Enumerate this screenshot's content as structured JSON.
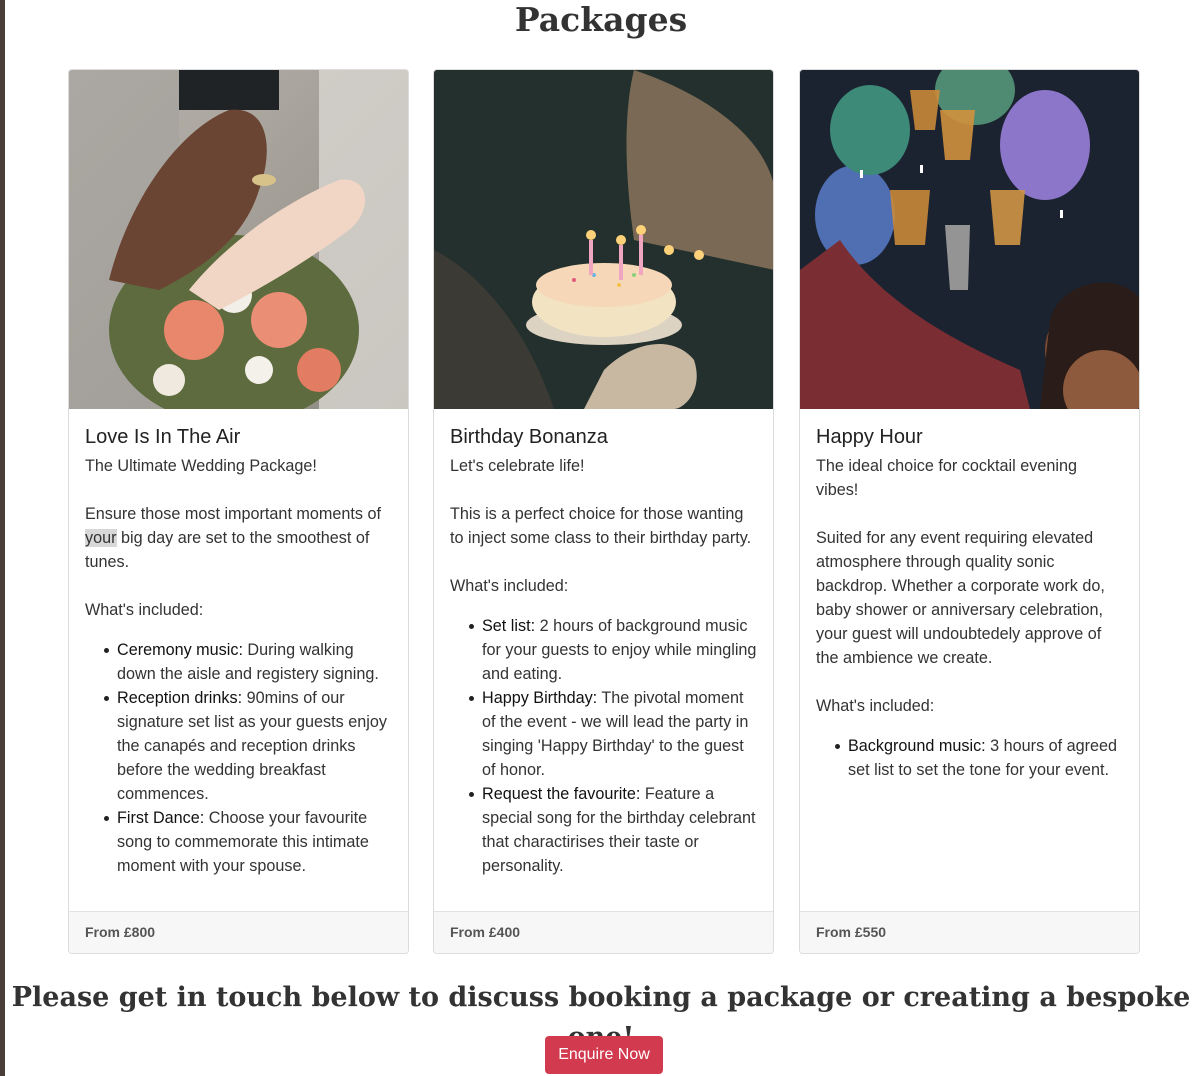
{
  "page": {
    "title": "Packages",
    "cta_heading": "Please get in touch below to discuss booking a package or creating a bespoke one!",
    "cta_button": "Enquire Now"
  },
  "colors": {
    "accent": "#d23a4f",
    "footer_bg": "#f7f7f7",
    "border": "#dcdcdc"
  },
  "packages": [
    {
      "image": "wedding-hands-bouquet",
      "title": "Love Is In The Air",
      "subtitle": "The Ultimate Wedding Package!",
      "desc_pre": "Ensure those most important moments of ",
      "desc_highlight": "your",
      "desc_post": " big day are set to the smoothest of tunes.",
      "included_label": "What's included:",
      "items": [
        {
          "label": "Ceremony music:",
          "text": " During walking down the aisle and registery signing."
        },
        {
          "label": "Reception drinks:",
          "text": " 90mins of our signature set list as your guests enjoy the canapés and reception drinks before the wedding breakfast commences."
        },
        {
          "label": "First Dance:",
          "text": " Choose your favourite song to commemorate this intimate moment with your spouse."
        }
      ],
      "price": "From £800"
    },
    {
      "image": "birthday-cake-candles",
      "title": "Birthday Bonanza",
      "subtitle": "Let's celebrate life!",
      "desc_pre": "This is a perfect choice for those wanting to inject some class to their birthday party.",
      "desc_highlight": "",
      "desc_post": "",
      "included_label": "What's included:",
      "items": [
        {
          "label": "Set list:",
          "text": " 2 hours of background music for your guests to enjoy while mingling and eating."
        },
        {
          "label": "Happy Birthday:",
          "text": " The pivotal moment of the event - we will lead the party in singing 'Happy Birthday' to the guest of honor."
        },
        {
          "label": "Request the favourite:",
          "text": " Feature a special song for the birthday celebrant that charactirises their taste or personality."
        }
      ],
      "price": "From £400"
    },
    {
      "image": "cocktail-toast-balloons",
      "title": "Happy Hour",
      "subtitle": "The ideal choice for cocktail evening vibes!",
      "desc_pre": "Suited for any event requiring elevated atmosphere through quality sonic backdrop. Whether a corporate work do, baby shower or anniversary celebration, your guest will undoubtedely approve of the ambience we create.",
      "desc_highlight": "",
      "desc_post": "",
      "included_label": "What's included:",
      "items": [
        {
          "label": "Background music:",
          "text": " 3 hours of agreed set list to set the tone for your event."
        }
      ],
      "price": "From £550"
    }
  ]
}
